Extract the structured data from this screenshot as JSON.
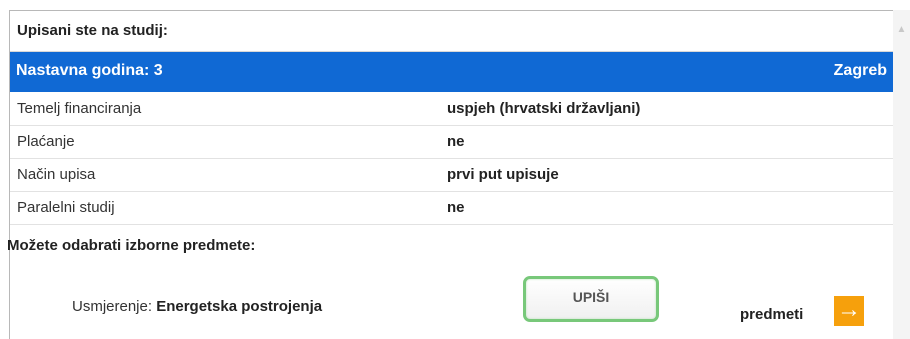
{
  "header": {
    "title": "Upisani ste na studij:"
  },
  "bluebar": {
    "year_label": "Nastavna godina: 3",
    "city": "Zagreb"
  },
  "rows": [
    {
      "label": "Temelj financiranja",
      "value": "uspjeh (hrvatski državljani)"
    },
    {
      "label": "Plaćanje",
      "value": "ne"
    },
    {
      "label": "Način upisa",
      "value": "prvi put upisuje"
    },
    {
      "label": "Paralelni studij",
      "value": "ne"
    }
  ],
  "electives": {
    "title": "Možete odabrati izborne predmete:",
    "direction_label": "Usmjerenje: ",
    "direction_value": "Energetska postrojenja",
    "enroll_label": "UPIŠI",
    "subjects_label": "predmeti",
    "arrow_icon": "arrow-right-icon"
  },
  "colors": {
    "accent": "#1069d4",
    "orange": "#f6a00c",
    "green_border": "#78c87a"
  }
}
